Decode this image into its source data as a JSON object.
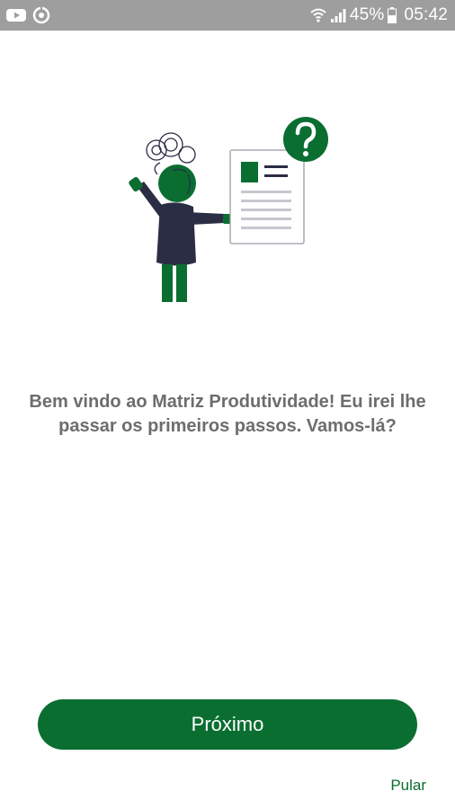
{
  "status_bar": {
    "battery_percent": "45%",
    "time": "05:42",
    "left_icons": [
      "youtube-icon",
      "sync-icon"
    ],
    "right_icons": [
      "wifi-icon",
      "cell-signal-icon",
      "battery-icon"
    ]
  },
  "onboarding": {
    "illustration": "person-pointing-at-document-with-question-mark",
    "message": "Bem vindo ao Matriz Produtividade! Eu irei lhe passar os primeiros passos. Vamos-lá?",
    "next_button_label": "Próximo",
    "skip_label": "Pular"
  },
  "colors": {
    "brand_green": "#0b6e31",
    "text_gray": "#6d6d6d",
    "status_bar_gray": "#9e9e9e",
    "figure_navy": "#2b2d45"
  }
}
